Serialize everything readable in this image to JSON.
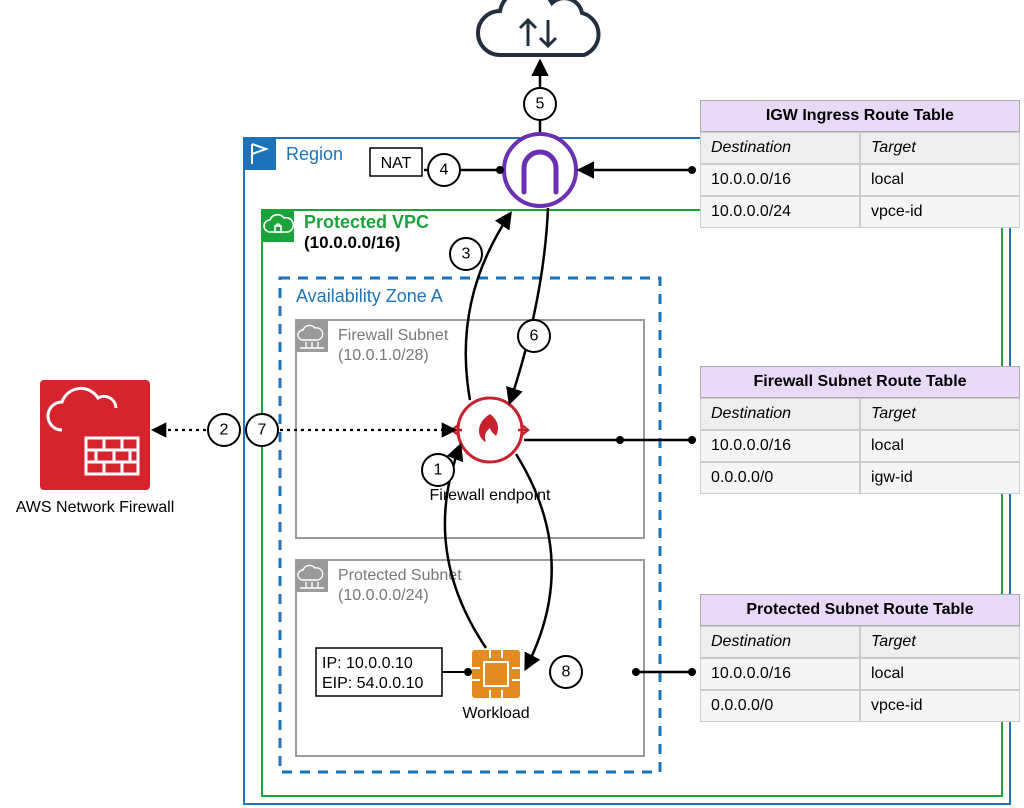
{
  "cloud_label": "",
  "region_label": "Region",
  "nat_label": "NAT",
  "vpc": {
    "name": "Protected VPC",
    "cidr": "(10.0.0.0/16)"
  },
  "az_label": "Availability Zone A",
  "firewall_subnet": {
    "name": "Firewall Subnet",
    "cidr": "(10.0.1.0/28)",
    "endpoint_label": "Firewall endpoint"
  },
  "protected_subnet": {
    "name": "Protected Subnet",
    "cidr": "(10.0.0.0/24)",
    "ip_line": "IP: 10.0.0.10",
    "eip_line": "EIP: 54.0.0.10",
    "workload_label": "Workload"
  },
  "service_label": "AWS Network Firewall",
  "steps": [
    "1",
    "2",
    "3",
    "4",
    "5",
    "6",
    "7",
    "8"
  ],
  "tables": {
    "igw": {
      "title": "IGW Ingress Route Table",
      "head": [
        "Destination",
        "Target"
      ],
      "rows": [
        [
          "10.0.0.0/16",
          "local"
        ],
        [
          "10.0.0.0/24",
          "vpce-id"
        ]
      ]
    },
    "fw": {
      "title": "Firewall Subnet Route Table",
      "head": [
        "Destination",
        "Target"
      ],
      "rows": [
        [
          "10.0.0.0/16",
          "local"
        ],
        [
          "0.0.0.0/0",
          "igw-id"
        ]
      ]
    },
    "prot": {
      "title": "Protected Subnet Route Table",
      "head": [
        "Destination",
        "Target"
      ],
      "rows": [
        [
          "10.0.0.0/16",
          "local"
        ],
        [
          "0.0.0.0/0",
          "vpce-id"
        ]
      ]
    }
  }
}
